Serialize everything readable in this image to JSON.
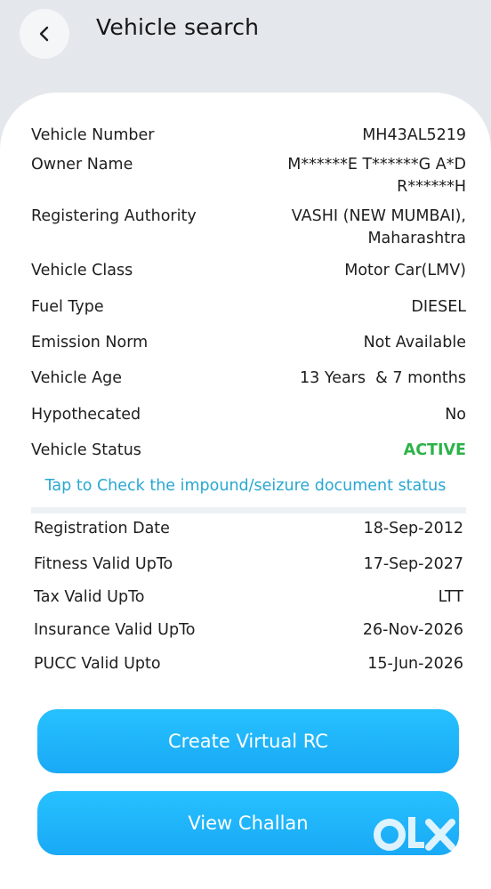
{
  "header": {
    "back_icon": "chevron-left-icon",
    "title": "Vehicle search"
  },
  "details": [
    {
      "label": "Vehicle Number",
      "value": "MH43AL5219"
    },
    {
      "label": "Owner Name",
      "value": "M******E T******G A*D R******H"
    },
    {
      "label": "Registering Authority",
      "value": "VASHI (NEW MUMBAI), Maharashtra"
    },
    {
      "label": "Vehicle Class",
      "value": "Motor Car(LMV)"
    },
    {
      "label": "Fuel Type",
      "value": "DIESEL"
    },
    {
      "label": "Emission Norm",
      "value": "Not Available"
    },
    {
      "label": "Vehicle Age",
      "value": "13 Years  & 7 months"
    },
    {
      "label": "Hypothecated",
      "value": "No"
    },
    {
      "label": "Vehicle Status",
      "value": "ACTIVE"
    }
  ],
  "impound_link": "Tap to Check the impound/seizure document status",
  "validity": [
    {
      "label": "Registration Date",
      "value": "18-Sep-2012"
    },
    {
      "label": "Fitness Valid UpTo",
      "value": "17-Sep-2027"
    },
    {
      "label": "Tax Valid UpTo",
      "value": "LTT"
    },
    {
      "label": "Insurance Valid UpTo",
      "value": "26-Nov-2026"
    },
    {
      "label": "PUCC Valid Upto",
      "value": "15-Jun-2026"
    }
  ],
  "buttons": {
    "create_rc": "Create Virtual RC",
    "view_challan": "View Challan"
  },
  "watermark": {
    "logo": "olx-logo",
    "text": "OLX"
  },
  "colors": {
    "background": "#e4e8ec",
    "status_active": "#2db24a",
    "link": "#29a7d3",
    "button": "#1eb3fa"
  }
}
